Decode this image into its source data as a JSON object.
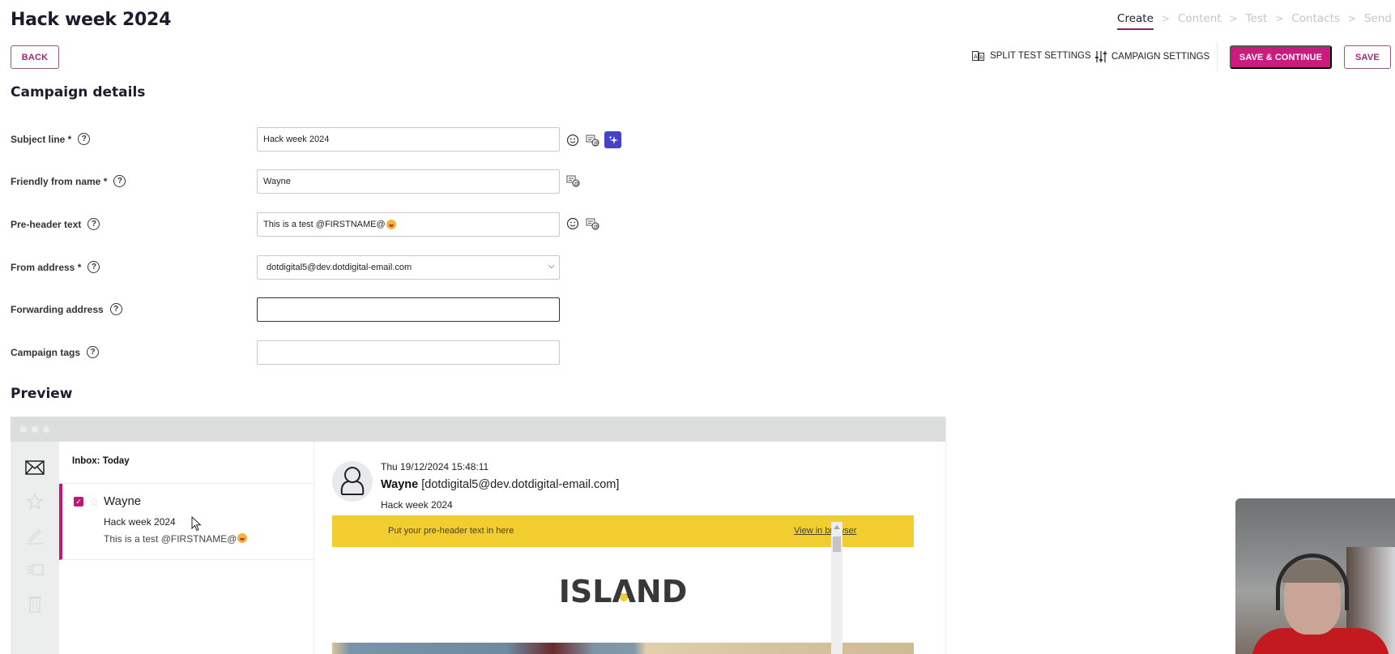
{
  "header": {
    "title": "Hack week 2024",
    "back_label": "BACK",
    "steps": [
      {
        "label": "Create",
        "active": true
      },
      {
        "label": "Content",
        "active": false
      },
      {
        "label": "Test",
        "active": false
      },
      {
        "label": "Contacts",
        "active": false
      },
      {
        "label": "Send",
        "active": false
      }
    ],
    "split_test_label": "SPLIT TEST SETTINGS",
    "campaign_settings_label": "CAMPAIGN SETTINGS",
    "save_continue_label": "SAVE & CONTINUE",
    "save_label": "SAVE"
  },
  "campaign_details": {
    "title": "Campaign details",
    "fields": {
      "subject_line": {
        "label": "Subject line *",
        "value": "Hack week 2024"
      },
      "friendly_from": {
        "label": "Friendly from name *",
        "value": "Wayne"
      },
      "preheader": {
        "label": "Pre-header text",
        "value": "This is a test @FIRSTNAME@"
      },
      "from_address": {
        "label": "From address *",
        "value": "dotdigital5@dev.dotdigital-email.com"
      },
      "forwarding": {
        "label": "Forwarding address",
        "value": ""
      },
      "tags": {
        "label": "Campaign tags",
        "value": ""
      }
    },
    "help_glyph": "?"
  },
  "preview": {
    "title": "Preview",
    "inbox_title": "Inbox: Today",
    "message": {
      "sender": "Wayne",
      "subject": "Hack week 2024",
      "preheader": "This is a test @FIRSTNAME@",
      "checked": true
    },
    "reading": {
      "date": "Thu 19/12/2024 15:48:11",
      "from_name": "Wayne",
      "from_address": "[dotdigital5@dev.dotdigital-email.com]",
      "subject": "Hack week 2024"
    },
    "email": {
      "preheader_placeholder": "Put your pre-header text in here",
      "view_in_browser": "View in browser",
      "logo_pre": "ISL",
      "logo_a": "A",
      "logo_post": "ND"
    }
  },
  "colors": {
    "brand_primary": "#cc1b7e",
    "accent_ai": "#4542c9",
    "email_banner": "#f1cd2f"
  }
}
